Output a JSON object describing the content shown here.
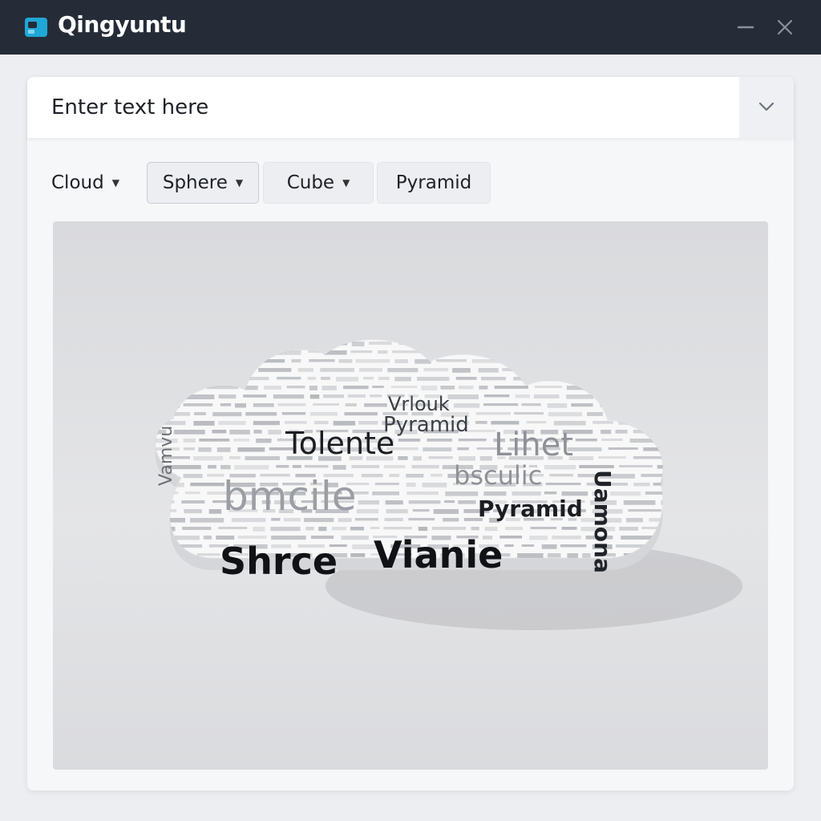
{
  "app": {
    "title": "Qingyuntu",
    "logo_icon": "app-logo-icon",
    "accent_color": "#1fa8d6"
  },
  "window_controls": {
    "minimize_icon": "minimize-icon",
    "close_icon": "close-icon"
  },
  "text_input": {
    "placeholder": "Enter text here",
    "value": "",
    "dropdown_icon": "chevron-down-icon"
  },
  "shape_selector": {
    "items": [
      {
        "label": "Cloud",
        "has_dropdown": true,
        "selected": false
      },
      {
        "label": "Sphere",
        "has_dropdown": true,
        "selected": true
      },
      {
        "label": "Cube",
        "has_dropdown": true,
        "selected": false
      },
      {
        "label": "Pyramid",
        "has_dropdown": false,
        "selected": false
      }
    ]
  },
  "preview": {
    "shape": "cloud",
    "words": [
      {
        "text": "Tolente",
        "weight": "primary"
      },
      {
        "text": "bmcile",
        "weight": "primary-gray"
      },
      {
        "text": "Shrce",
        "weight": "primary"
      },
      {
        "text": "Vianie",
        "weight": "primary"
      },
      {
        "text": "Pyramid",
        "weight": "secondary"
      },
      {
        "text": "Pyramid",
        "weight": "secondary"
      },
      {
        "text": "Lihet",
        "weight": "secondary-gray"
      },
      {
        "text": "bsculic",
        "weight": "secondary-gray"
      },
      {
        "text": "Vrlouk",
        "weight": "tertiary"
      },
      {
        "text": "Uamona",
        "weight": "vertical"
      },
      {
        "text": "Vamvu",
        "weight": "vertical-gray"
      }
    ]
  }
}
